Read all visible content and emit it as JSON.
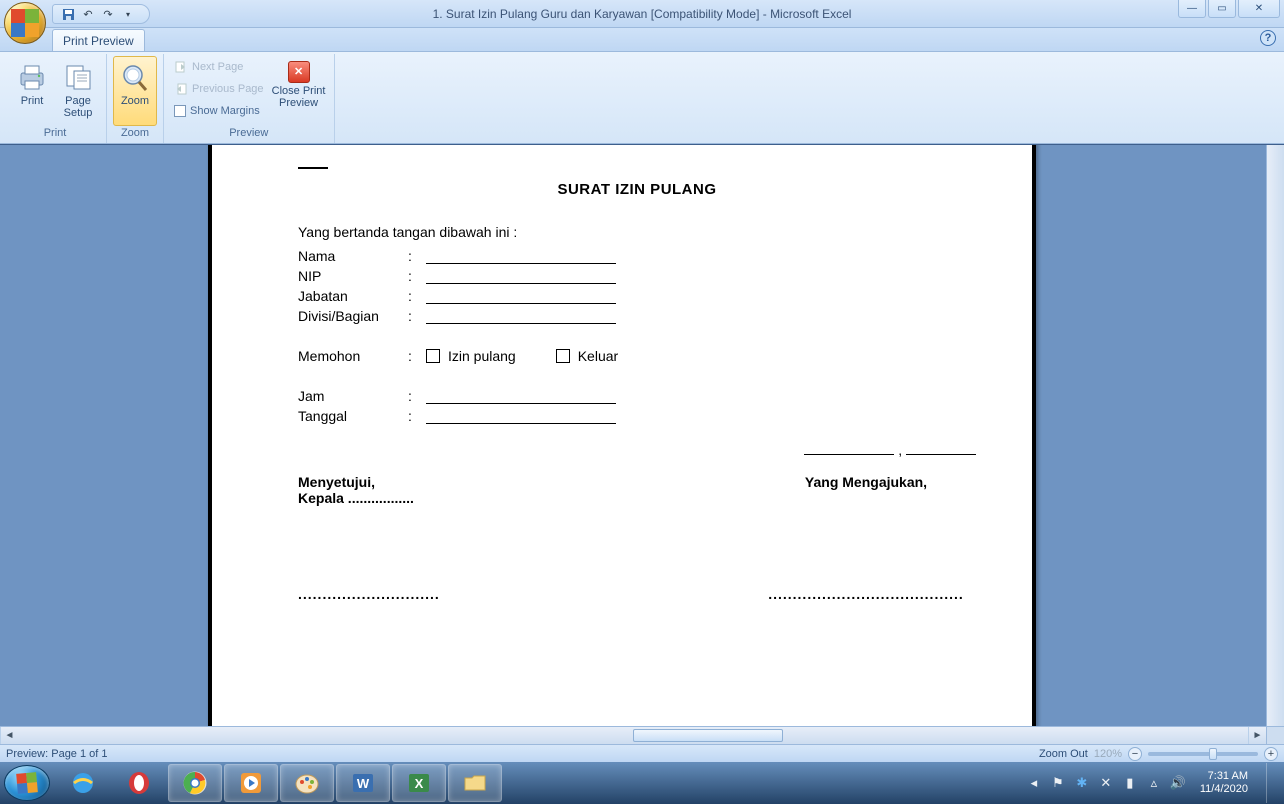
{
  "titlebar": {
    "title": "1. Surat Izin Pulang Guru dan Karyawan  [Compatibility Mode] - Microsoft Excel"
  },
  "tab": {
    "label": "Print Preview"
  },
  "ribbon": {
    "print": {
      "label": "Print",
      "setup": "Page Setup",
      "group": "Print"
    },
    "zoom": {
      "label": "Zoom",
      "group": "Zoom"
    },
    "preview": {
      "next": "Next Page",
      "prev": "Previous Page",
      "margins": "Show Margins",
      "close_l1": "Close Print",
      "close_l2": "Preview",
      "group": "Preview"
    }
  },
  "document": {
    "title": "SURAT IZIN PULANG",
    "intro": "Yang bertanda tangan dibawah ini :",
    "fields": {
      "nama": "Nama",
      "nip": "NIP",
      "jabatan": "Jabatan",
      "divisi": "Divisi/Bagian",
      "memohon": "Memohon",
      "izin_pulang": "Izin pulang",
      "keluar": "Keluar",
      "jam": "Jam",
      "tanggal": "Tanggal"
    },
    "sig": {
      "menyetujui": "Menyetujui,",
      "kepala": "Kepala .................",
      "yang": "Yang Mengajukan,",
      "dots_left": ".............................",
      "dots_right": "........................................"
    },
    "comma": ","
  },
  "statusbar": {
    "left": "Preview: Page 1 of 1",
    "zoom_label": "Zoom Out",
    "zoom_pct": "120%"
  },
  "taskbar": {
    "time": "7:31 AM",
    "date": "11/4/2020"
  }
}
